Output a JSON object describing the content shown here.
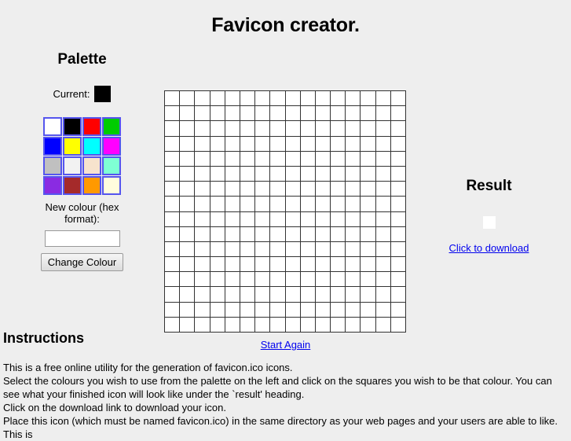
{
  "page": {
    "title": "Favicon creator."
  },
  "palette": {
    "heading": "Palette",
    "current_label": "Current:",
    "current_colour": "#000000",
    "swatches": [
      {
        "name": "white",
        "hex": "#ffffff"
      },
      {
        "name": "black",
        "hex": "#000000"
      },
      {
        "name": "red",
        "hex": "#ff0000"
      },
      {
        "name": "green",
        "hex": "#00cc00"
      },
      {
        "name": "blue",
        "hex": "#0000ff"
      },
      {
        "name": "yellow",
        "hex": "#ffff00"
      },
      {
        "name": "cyan",
        "hex": "#00ffff"
      },
      {
        "name": "magenta",
        "hex": "#ff00ff"
      },
      {
        "name": "silver",
        "hex": "#c0c0c0"
      },
      {
        "name": "whitesmoke",
        "hex": "#f2f2f2"
      },
      {
        "name": "bisque",
        "hex": "#f7e3cd"
      },
      {
        "name": "aquamarine",
        "hex": "#7fffd4"
      },
      {
        "name": "purple",
        "hex": "#8a2be2"
      },
      {
        "name": "brown",
        "hex": "#a52a2a"
      },
      {
        "name": "orange",
        "hex": "#ff9900"
      },
      {
        "name": "lightyellow",
        "hex": "#fffddd"
      }
    ],
    "new_colour_label": "New colour (hex format):",
    "hex_input_value": "",
    "hex_input_placeholder": "",
    "change_colour_label": "Change Colour"
  },
  "canvas": {
    "columns": 16,
    "rows": 16,
    "cell_colour": "#ffffff",
    "start_again_label": "Start Again"
  },
  "result": {
    "heading": "Result",
    "preview_colour": "#ffffff",
    "download_label": "Click to download"
  },
  "instructions": {
    "heading": "Instructions",
    "lines": [
      "This is a free online utility for the generation of favicon.ico icons.",
      "Select the colours you wish to use from the palette on the left and click on the squares you wish to be that colour. You can see what your finished icon will look like under the `result' heading.",
      "Click on the download link to download your icon.",
      "Place this icon (which must be named favicon.ico) in the same directory as your web pages and your users are able to like. This is"
    ]
  },
  "colors": {
    "page_background": "#eeeeee",
    "link": "#0000ee",
    "grid_line": "#333333",
    "swatch_border": "#5555ee"
  }
}
